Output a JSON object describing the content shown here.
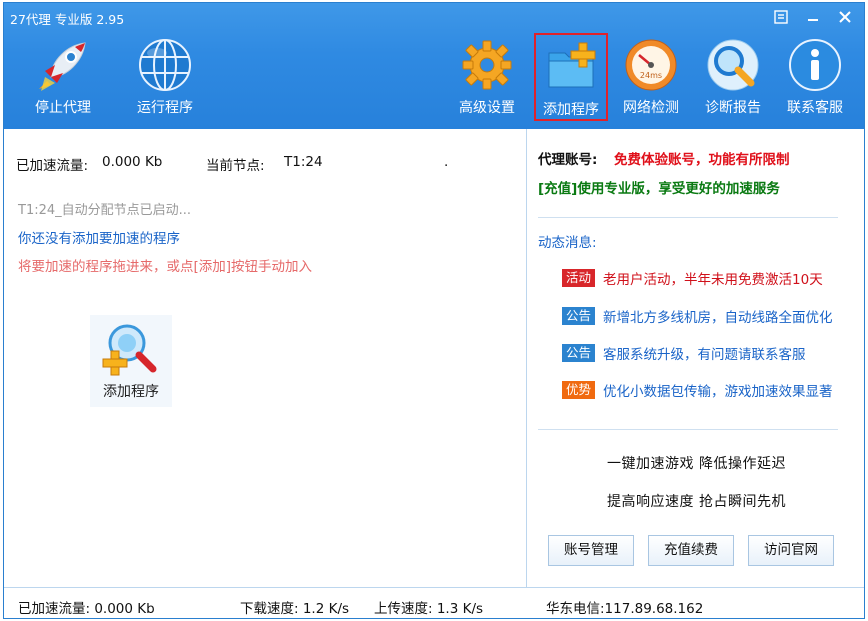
{
  "window": {
    "title": "27代理 专业版 2.95"
  },
  "toolbar": {
    "stop_proxy": "停止代理",
    "run_program": "运行程序",
    "advanced_settings": "高级设置",
    "add_program": "添加程序",
    "network_check": "网络检测",
    "diagnose_report": "诊断报告",
    "contact_support": "联系客服",
    "gauge_text": "24ms"
  },
  "main": {
    "accelerated_label": "已加速流量:",
    "accelerated_value": "0.000 Kb",
    "node_label": "当前节点:",
    "node_value": "T1:24",
    "dot": ".",
    "log_line1": "T1:24_自动分配节点已启动...",
    "log_line2": "你还没有添加要加速的程序",
    "log_line3": "将要加速的程序拖进来，或点[添加]按钮手动加入",
    "add_tile_label": "添加程序"
  },
  "side": {
    "account_label": "代理账号:",
    "account_value": "免费体验账号，功能有所限制",
    "upgrade_text": "[充值]使用专业版，享受更好的加速服务",
    "news_title": "动态消息:",
    "news": [
      {
        "tag": "活动",
        "text": "老用户活动，半年未用免费激活10天"
      },
      {
        "tag": "公告",
        "text": "新增北方多线机房，自动线路全面优化"
      },
      {
        "tag": "公告",
        "text": "客服系统升级，有问题请联系客服"
      },
      {
        "tag": "优势",
        "text": "优化小数据包传输，游戏加速效果显著"
      }
    ],
    "promo1": "一键加速游戏  降低操作延迟",
    "promo2": "提高响应速度  抢占瞬间先机",
    "btn_account": "账号管理",
    "btn_recharge": "充值续费",
    "btn_website": "访问官网"
  },
  "status": {
    "accelerated": "已加速流量: 0.000 Kb",
    "download": "下载速度: 1.2 K/s",
    "upload": "上传速度: 1.3 K/s",
    "server": "华东电信:117.89.68.162"
  },
  "colors": {
    "titlebar": "#2f8ae2",
    "accent_red": "#e0101a",
    "accent_green": "#0a7a12",
    "link_blue": "#1a64c8"
  }
}
